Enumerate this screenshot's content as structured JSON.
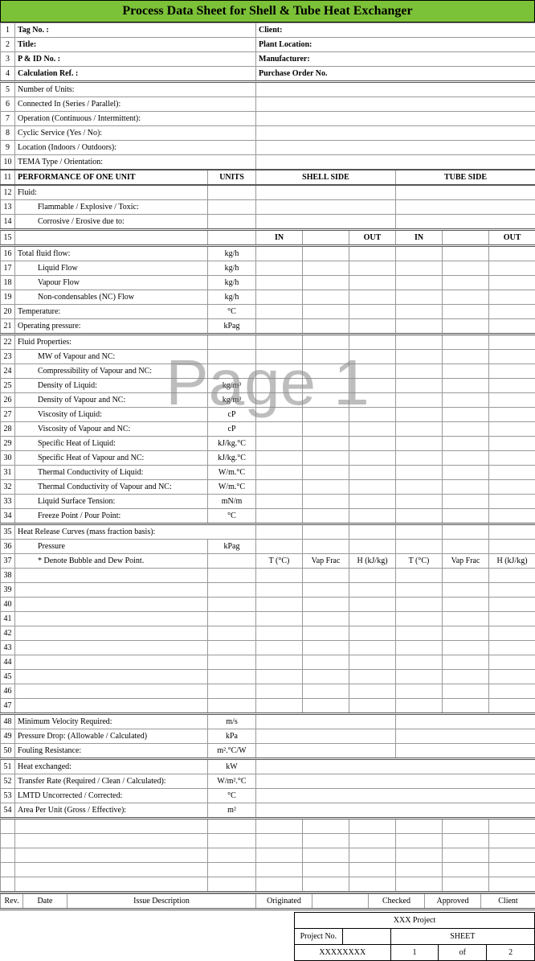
{
  "title": "Process Data Sheet for Shell & Tube Heat Exchanger",
  "watermark": "Page 1",
  "hdr": {
    "r1l": "Tag No. :",
    "r1r": "Client:",
    "r2l": "Title:",
    "r2r": "Plant Location:",
    "r3l": "P & ID No. :",
    "r3r": "Manufacturer:",
    "r4l": "Calculation Ref. :",
    "r4r": "Purchase Order No."
  },
  "rows": {
    "r5": "Number of Units:",
    "r6": "Connected In (Series / Parallel):",
    "r7": "Operation (Continuous / Intermittent):",
    "r8": "Cyclic Service (Yes / No):",
    "r9": "Location (Indoors / Outdoors):",
    "r10": "TEMA Type / Orientation:",
    "r11": "PERFORMANCE OF ONE UNIT",
    "r12": "Fluid:",
    "r13": "Flammable / Explosive / Toxic:",
    "r14": "Corrosive / Erosive due to:",
    "r16": "Total fluid flow:",
    "r17": "Liquid Flow",
    "r18": "Vapour Flow",
    "r19": "Non-condensables (NC) Flow",
    "r20": "Temperature:",
    "r21": "Operating pressure:",
    "r22": "Fluid Properties:",
    "r23": "MW of Vapour and NC:",
    "r24": "Compressibility of Vapour and NC:",
    "r25": "Density of Liquid:",
    "r26": "Density of Vapour and NC:",
    "r27": "Viscosity of Liquid:",
    "r28": "Viscosity of Vapour and NC:",
    "r29": "Specific Heat of Liquid:",
    "r30": "Specific Heat of Vapour and NC:",
    "r31": "Thermal Conductivity of Liquid:",
    "r32": "Thermal Conductivity of Vapour and NC:",
    "r33": "Liquid Surface Tension:",
    "r34": "Freeze Point / Pour Point:",
    "r35": "Heat Release Curves (mass fraction basis):",
    "r36": "Pressure",
    "r37": "* Denote Bubble and Dew Point.",
    "r48": "Minimum Velocity Required:",
    "r49": "Pressure Drop: (Allowable / Calculated)",
    "r50": "Fouling Resistance:",
    "r51": "Heat exchanged:",
    "r52": "Transfer Rate (Required / Clean / Calculated):",
    "r53": "LMTD Uncorrected / Corrected:",
    "r54": "Area Per Unit (Gross / Effective):"
  },
  "cols": {
    "units": "UNITS",
    "shell": "SHELL SIDE",
    "tube": "TUBE SIDE",
    "in": "IN",
    "out": "OUT",
    "tc": "T (°C)",
    "vf": "Vap Frac",
    "h": "H (kJ/kg)"
  },
  "units": {
    "kgh": "kg/h",
    "c": "°C",
    "kpag": "kPag",
    "kgm3": "kg/m³",
    "cp": "cP",
    "kjkgc": "kJ/kg.°C",
    "wmc": "W/m.°C",
    "mnm": "mN/m",
    "kpa": "kPa",
    "ms": "m/s",
    "m2cw": "m².°C/W",
    "kw": "kW",
    "wm2c": "W/m².°C",
    "m2": "m²"
  },
  "rev": {
    "rev": "Rev.",
    "date": "Date",
    "desc": "Issue Description",
    "orig": "Originated",
    "chk": "Checked",
    "app": "Approved",
    "cli": "Client"
  },
  "foot": {
    "proj": "XXX Project",
    "pno": "Project No.",
    "pval": "XXXXXXXX",
    "sheet": "SHEET",
    "pg": "1",
    "of": "of",
    "tot": "2"
  }
}
